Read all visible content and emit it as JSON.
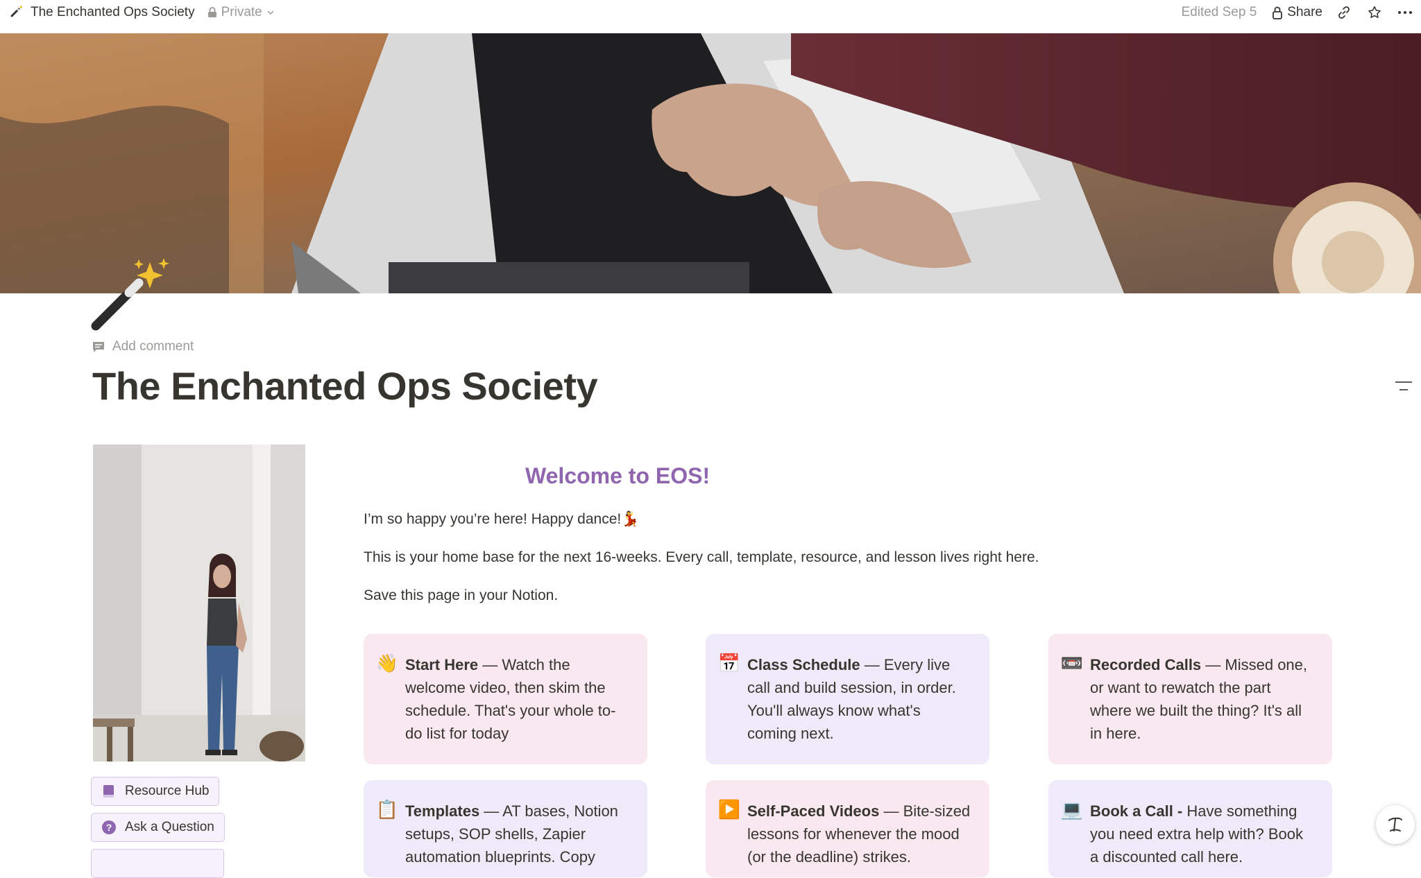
{
  "topbar": {
    "title": "The Enchanted Ops Society",
    "privacy": "Private",
    "edited": "Edited Sep 5",
    "share": "Share"
  },
  "page": {
    "add_comment": "Add comment",
    "title": "The Enchanted Ops Society"
  },
  "welcome": {
    "heading": "Welcome to EOS!",
    "p1": "I’m so happy you’re here! Happy dance!💃",
    "p2": "This is your home base for the next 16-weeks. Every call, template, resource, and lesson lives right here.",
    "p3": "Save this page in your Notion."
  },
  "sidebar_buttons": [
    {
      "label": "Resource Hub",
      "icon": "book-icon"
    },
    {
      "label": "Ask a Question",
      "icon": "question-icon"
    }
  ],
  "cards": [
    {
      "icon": "👋",
      "bold": "Start Here",
      "text": " — Watch the welcome video, then skim the schedule. That's your whole to-do list for today"
    },
    {
      "icon": "📅",
      "bold": "Class Schedule",
      "text": " — Every live call and build session, in order. You'll always know what's coming next."
    },
    {
      "icon": "📼",
      "bold": "Recorded Calls",
      "text": " — Missed one, or want to rewatch the part where we built the thing? It's all in here."
    },
    {
      "icon": "📋",
      "bold": "Templates",
      "text": " — AT bases, Notion setups, SOP shells, Zapier automation blueprints. Copy"
    },
    {
      "icon": "▶️",
      "bold": "Self-Paced Videos",
      "text": " — Bite-sized lessons for whenever the mood (or the deadline) strikes."
    },
    {
      "icon": "💻",
      "bold": "Book a Call -",
      "text": " Have something you need extra help with? Book a discounted call here."
    }
  ],
  "colors": {
    "accent": "#9065b0",
    "card_pink": "#f9e8ef",
    "card_lavender": "#efeafa"
  }
}
